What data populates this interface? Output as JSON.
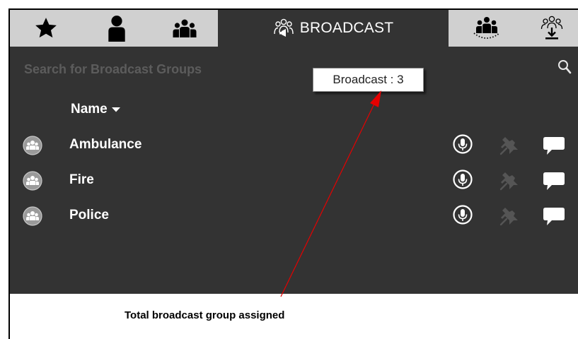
{
  "tabs": [
    {
      "icon": "star-icon",
      "label": ""
    },
    {
      "icon": "user-icon",
      "label": ""
    },
    {
      "icon": "group-icon",
      "label": ""
    },
    {
      "icon": "broadcast-icon",
      "label": "BROADCAST",
      "active": true
    },
    {
      "icon": "group-dotted-icon",
      "label": ""
    },
    {
      "icon": "group-download-icon",
      "label": ""
    }
  ],
  "search": {
    "placeholder": "Search for Broadcast Groups"
  },
  "tooltip": {
    "text": "Broadcast : 3"
  },
  "list": {
    "column_header": "Name",
    "rows": [
      {
        "name": "Ambulance"
      },
      {
        "name": "Fire"
      },
      {
        "name": "Police"
      }
    ]
  },
  "annotation": {
    "caption": "Total broadcast group assigned"
  },
  "colors": {
    "panel": "#333333",
    "tabbar": "#d0d0d0",
    "arrow": "#e60000"
  }
}
